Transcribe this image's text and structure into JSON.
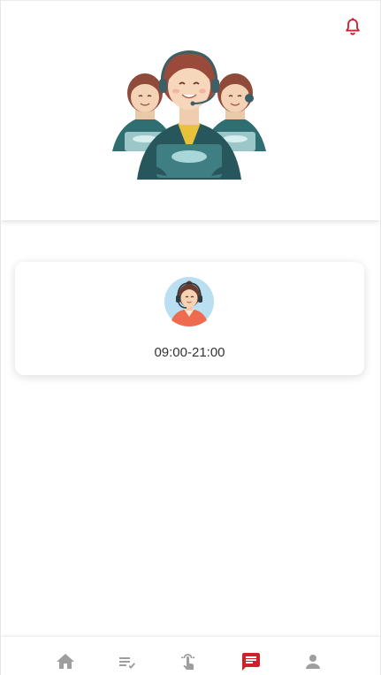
{
  "header": {
    "notification_icon": "bell-icon",
    "hero_image": "customer-service-agents-illustration"
  },
  "service_card": {
    "avatar_icon": "support-agent-avatar",
    "hours": "09:00-21:00"
  },
  "tabbar": {
    "active_color": "#d0202c",
    "inactive_color": "#9e9e9e",
    "tabs": [
      {
        "icon": "home-icon",
        "active": false
      },
      {
        "icon": "checklist-icon",
        "active": false
      },
      {
        "icon": "touch-icon",
        "active": false
      },
      {
        "icon": "message-icon",
        "active": true
      },
      {
        "icon": "person-icon",
        "active": false
      }
    ]
  }
}
